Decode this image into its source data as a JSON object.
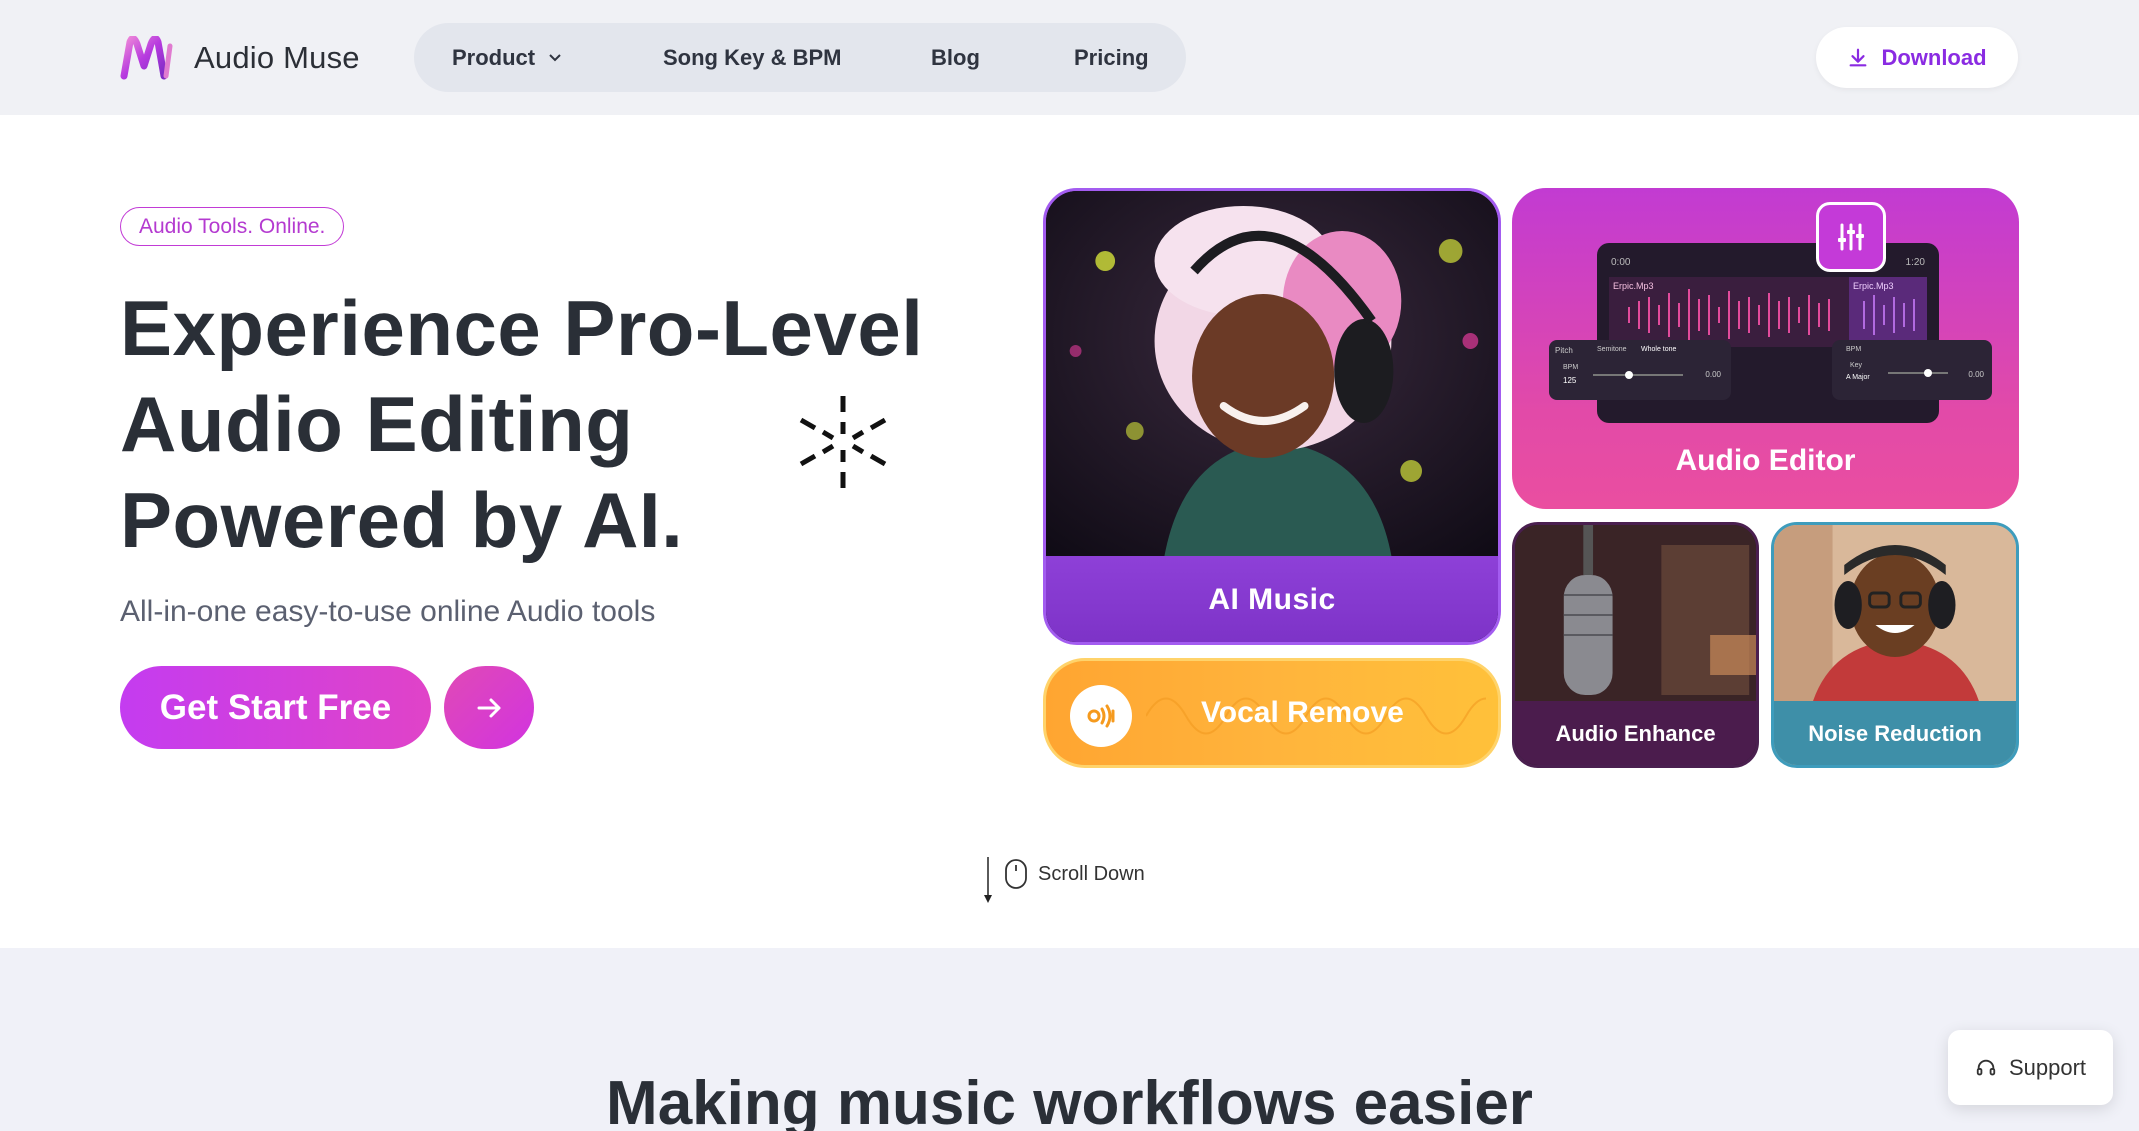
{
  "brand": {
    "name": "Audio Muse",
    "accent": "#c23bd6"
  },
  "nav": {
    "items": [
      {
        "label": "Product",
        "has_dropdown": true
      },
      {
        "label": "Song Key & BPM"
      },
      {
        "label": "Blog"
      },
      {
        "label": "Pricing"
      }
    ]
  },
  "header": {
    "download_label": "Download"
  },
  "hero": {
    "pill": "Audio Tools. Online.",
    "title_line1": "Experience Pro-Level",
    "title_line2": "Audio Editing",
    "title_line3": "Powered by AI.",
    "subtitle": "All-in-one easy-to-use online Audio tools",
    "cta_label": "Get Start Free"
  },
  "cards": {
    "ai_music": "AI Music",
    "audio_editor": "Audio Editor",
    "vocal_remove": "Vocal Remove",
    "audio_enhance": "Audio Enhance",
    "noise_reduction": "Noise Reduction"
  },
  "editor_mock": {
    "time_start": "0:00",
    "time_end": "1:20",
    "track1": "Erpic.Mp3",
    "track2": "Erpic.Mp3",
    "pitch": "Pitch",
    "semitone": "Semitone",
    "whole_tone": "Whole tone",
    "bpm_label": "BPM",
    "bpm_value": "125",
    "val_left": "0.00",
    "bpm_label2": "BPM",
    "key_label": "Key",
    "key_value": "A Major",
    "val_right": "0.00"
  },
  "scroll_label": "Scroll Down",
  "section": {
    "title": "Making music workflows easier"
  },
  "support_label": "Support"
}
